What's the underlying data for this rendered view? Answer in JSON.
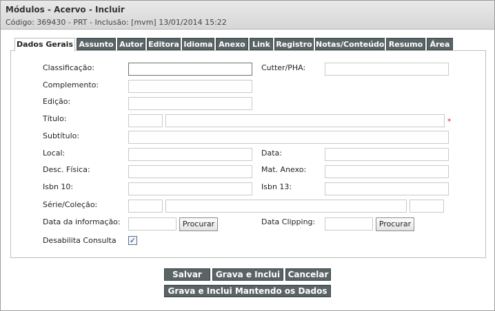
{
  "header": {
    "title": "Módulos - Acervo - Incluir",
    "subtitle": "Código: 369430 - PRT - Inclusão: [mvm] 13/01/2014 15:22"
  },
  "tabs": [
    {
      "label": "Dados Gerais",
      "active": true
    },
    {
      "label": "Assunto"
    },
    {
      "label": "Autor"
    },
    {
      "label": "Editora"
    },
    {
      "label": "Idioma"
    },
    {
      "label": "Anexo"
    },
    {
      "label": "Link"
    },
    {
      "label": "Registro"
    },
    {
      "label": "Notas/Conteúdo"
    },
    {
      "label": "Resumo"
    },
    {
      "label": "Área"
    }
  ],
  "form": {
    "classificacao": {
      "label": "Classificação:",
      "value": ""
    },
    "cutter": {
      "label": "Cutter/PHA:",
      "value": ""
    },
    "complemento": {
      "label": "Complemento:",
      "value": ""
    },
    "edicao": {
      "label": "Edição:",
      "value": ""
    },
    "titulo": {
      "label": "Título:",
      "prefix": "",
      "value": "",
      "required_mark": "*"
    },
    "subtitulo": {
      "label": "Subtítulo:",
      "value": ""
    },
    "local": {
      "label": "Local:",
      "value": ""
    },
    "data": {
      "label": "Data:",
      "value": ""
    },
    "desc_fisica": {
      "label": "Desc. Física:",
      "value": ""
    },
    "mat_anexo": {
      "label": "Mat. Anexo:",
      "value": ""
    },
    "isbn10": {
      "label": "Isbn 10:",
      "value": ""
    },
    "isbn13": {
      "label": "Isbn 13:",
      "value": ""
    },
    "serie": {
      "label": "Série/Coleção:",
      "a": "",
      "b": "",
      "c": ""
    },
    "data_info": {
      "label": "Data da informação:",
      "value": "",
      "button": "Procurar"
    },
    "data_clipping": {
      "label": "Data Clipping:",
      "value": "",
      "button": "Procurar"
    },
    "desabilita": {
      "label": "Desabilita Consulta",
      "checked": true,
      "check_glyph": "✓"
    }
  },
  "actions": {
    "salvar": "Salvar",
    "grava_inclui": "Grava e Inclui",
    "cancelar": "Cancelar",
    "grava_mantendo": "Grava e Inclui Mantendo os Dados"
  },
  "colors": {
    "tab_bg": "#5a6466",
    "header_bg": "#dcdcdc",
    "required": "#cc2222"
  }
}
